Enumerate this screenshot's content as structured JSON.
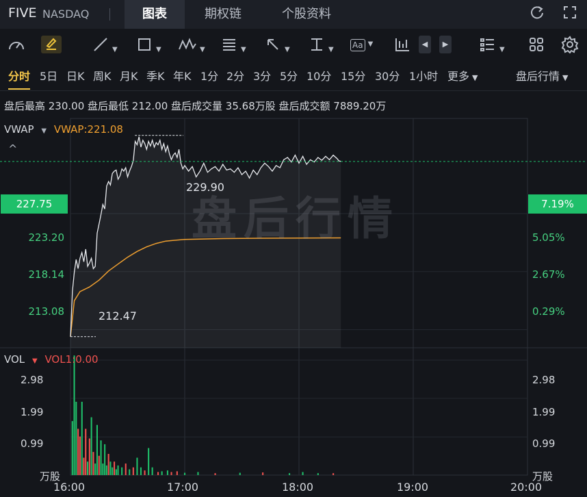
{
  "header": {
    "symbol": "FIVE",
    "exchange": "NASDAQ",
    "tabs": [
      {
        "label": "图表",
        "active": true
      },
      {
        "label": "期权链",
        "active": false
      },
      {
        "label": "个股资料",
        "active": false
      }
    ]
  },
  "toolbar": {
    "icons": [
      "gauge-icon",
      "pencil-icon",
      "line-tool-icon",
      "rectangle-icon",
      "pattern-icon",
      "fib-icon",
      "arrow-icon",
      "vertical-line-icon",
      "text-icon",
      "candle-icon",
      "list-icon",
      "grid-icon",
      "settings-icon"
    ],
    "text_tool_label": "Aa"
  },
  "periods": {
    "items": [
      "分时",
      "5日",
      "日K",
      "周K",
      "月K",
      "季K",
      "年K",
      "1分",
      "2分",
      "3分",
      "5分",
      "10分",
      "15分",
      "30分",
      "1小时",
      "更多"
    ],
    "active": "分时",
    "session": "盘后行情"
  },
  "stats": "盘后最高 230.00  盘后最低 212.00  盘后成交量 35.68万股  盘后成交额 7889.20万",
  "price_panel": {
    "indicator": "VWAP",
    "indicator_value": "VWAP:221.08",
    "left_axis": [
      "227.75",
      "223.20",
      "218.14",
      "213.08"
    ],
    "right_axis": [
      "7.19%",
      "5.05%",
      "2.67%",
      "0.29%"
    ],
    "current_price": "227.75",
    "current_pct": "7.19%",
    "high_label": "229.90",
    "low_label": "212.47",
    "watermark": "盘后行情"
  },
  "volume_panel": {
    "indicator": "VOL",
    "indicator_value": "VOL1:0.00",
    "left_axis": [
      "2.98",
      "1.99",
      "0.99",
      "万股"
    ],
    "right_axis": [
      "2.98",
      "1.99",
      "0.99",
      "万股"
    ]
  },
  "time_axis": [
    "16:00",
    "17:00",
    "18:00",
    "19:00",
    "20:00"
  ],
  "colors": {
    "up": "#1fbf6a",
    "down": "#f0524f",
    "vwap": "#f0a030",
    "accent": "#f3c64a"
  },
  "chart_data": {
    "type": "line",
    "x_start": "16:00",
    "x_end": "20:00",
    "minutes": [
      0,
      1,
      2,
      3,
      4,
      5,
      6,
      7,
      8,
      9,
      10,
      11,
      12,
      13,
      14,
      15,
      16,
      17,
      18,
      19,
      20,
      21,
      22,
      23,
      24,
      25,
      26,
      27,
      28,
      29,
      30,
      31,
      32,
      33,
      34,
      35,
      36,
      37,
      38,
      39,
      40,
      41,
      42,
      43,
      44,
      45,
      46,
      47,
      48,
      49,
      50,
      51,
      52,
      53,
      54,
      55,
      56,
      57,
      58,
      59,
      60,
      62,
      64,
      66,
      68,
      70,
      72,
      74,
      76,
      78,
      80,
      82,
      84,
      86,
      88,
      90,
      92,
      94,
      96,
      98,
      100,
      102,
      104,
      106,
      108,
      110,
      112,
      114,
      116,
      118,
      120,
      122,
      124,
      126,
      128,
      130,
      132,
      134,
      136,
      138,
      140,
      141,
      142
    ],
    "price": [
      212.47,
      216.4,
      218.1,
      219.2,
      218.4,
      219.3,
      219.8,
      219.0,
      220.1,
      218.6,
      218.9,
      219.3,
      218.4,
      218.6,
      221.5,
      222.3,
      223.1,
      224.0,
      223.6,
      225.6,
      226.0,
      225.7,
      226.7,
      226.9,
      227.0,
      226.2,
      226.5,
      227.1,
      226.9,
      227.2,
      226.4,
      226.9,
      227.3,
      227.8,
      229.5,
      229.2,
      229.9,
      229.0,
      229.6,
      229.3,
      228.8,
      229.5,
      229.1,
      229.6,
      229.0,
      229.4,
      229.2,
      229.6,
      228.8,
      229.3,
      228.6,
      229.1,
      228.4,
      227.9,
      228.3,
      228.5,
      228.1,
      228.8,
      227.6,
      227.1,
      227.4,
      226.9,
      227.3,
      226.4,
      226.9,
      227.6,
      226.8,
      227.1,
      227.3,
      226.9,
      227.5,
      227.0,
      227.1,
      226.8,
      227.2,
      226.6,
      226.9,
      226.3,
      227.0,
      226.6,
      227.2,
      227.6,
      227.3,
      226.9,
      227.4,
      227.2,
      227.9,
      228.1,
      227.7,
      228.3,
      227.6,
      228.2,
      227.5,
      227.9,
      227.7,
      228.1,
      227.85,
      228.2,
      227.9,
      228.3,
      228.0,
      227.8,
      227.75
    ],
    "vwap_series": [
      {
        "m": 0,
        "v": 212.47
      },
      {
        "m": 2,
        "v": 215.6
      },
      {
        "m": 5,
        "v": 216.4
      },
      {
        "m": 10,
        "v": 216.8
      },
      {
        "m": 15,
        "v": 217.4
      },
      {
        "m": 20,
        "v": 218.2
      },
      {
        "m": 25,
        "v": 218.8
      },
      {
        "m": 30,
        "v": 219.4
      },
      {
        "m": 35,
        "v": 219.9
      },
      {
        "m": 40,
        "v": 220.3
      },
      {
        "m": 45,
        "v": 220.6
      },
      {
        "m": 50,
        "v": 220.8
      },
      {
        "m": 60,
        "v": 220.95
      },
      {
        "m": 80,
        "v": 221.02
      },
      {
        "m": 100,
        "v": 221.05
      },
      {
        "m": 120,
        "v": 221.07
      },
      {
        "m": 142,
        "v": 221.08
      }
    ],
    "ylim": [
      211.5,
      231.5
    ],
    "volume": [
      {
        "m": 1,
        "v": 1.4,
        "d": "up"
      },
      {
        "m": 2,
        "v": 3.1,
        "d": "up"
      },
      {
        "m": 3,
        "v": 1.9,
        "d": "up"
      },
      {
        "m": 4,
        "v": 1.2,
        "d": "down"
      },
      {
        "m": 5,
        "v": 1.0,
        "d": "down"
      },
      {
        "m": 6,
        "v": 1.9,
        "d": "up"
      },
      {
        "m": 7,
        "v": 0.45,
        "d": "down"
      },
      {
        "m": 8,
        "v": 1.2,
        "d": "down"
      },
      {
        "m": 9,
        "v": 0.35,
        "d": "up"
      },
      {
        "m": 10,
        "v": 0.95,
        "d": "down"
      },
      {
        "m": 11,
        "v": 1.5,
        "d": "up"
      },
      {
        "m": 12,
        "v": 0.6,
        "d": "down"
      },
      {
        "m": 13,
        "v": 0.3,
        "d": "up"
      },
      {
        "m": 14,
        "v": 1.3,
        "d": "up"
      },
      {
        "m": 15,
        "v": 0.5,
        "d": "down"
      },
      {
        "m": 16,
        "v": 0.9,
        "d": "up"
      },
      {
        "m": 17,
        "v": 0.3,
        "d": "up"
      },
      {
        "m": 18,
        "v": 0.8,
        "d": "up"
      },
      {
        "m": 19,
        "v": 0.25,
        "d": "up"
      },
      {
        "m": 20,
        "v": 0.55,
        "d": "down"
      },
      {
        "m": 21,
        "v": 0.35,
        "d": "up"
      },
      {
        "m": 22,
        "v": 0.2,
        "d": "up"
      },
      {
        "m": 23,
        "v": 0.35,
        "d": "down"
      },
      {
        "m": 24,
        "v": 0.15,
        "d": "up"
      },
      {
        "m": 25,
        "v": 0.25,
        "d": "up"
      },
      {
        "m": 27,
        "v": 0.2,
        "d": "up"
      },
      {
        "m": 29,
        "v": 0.3,
        "d": "down"
      },
      {
        "m": 31,
        "v": 0.15,
        "d": "up"
      },
      {
        "m": 33,
        "v": 0.2,
        "d": "down"
      },
      {
        "m": 35,
        "v": 0.45,
        "d": "up"
      },
      {
        "m": 37,
        "v": 0.2,
        "d": "up"
      },
      {
        "m": 39,
        "v": 0.12,
        "d": "down"
      },
      {
        "m": 41,
        "v": 0.7,
        "d": "up"
      },
      {
        "m": 43,
        "v": 0.2,
        "d": "up"
      },
      {
        "m": 46,
        "v": 0.08,
        "d": "down"
      },
      {
        "m": 48,
        "v": 0.1,
        "d": "up"
      },
      {
        "m": 51,
        "v": 0.12,
        "d": "up"
      },
      {
        "m": 53,
        "v": 0.08,
        "d": "down"
      },
      {
        "m": 56,
        "v": 0.1,
        "d": "down"
      },
      {
        "m": 60,
        "v": 0.06,
        "d": "up"
      },
      {
        "m": 67,
        "v": 0.08,
        "d": "up"
      },
      {
        "m": 76,
        "v": 0.05,
        "d": "down"
      },
      {
        "m": 89,
        "v": 0.06,
        "d": "up"
      },
      {
        "m": 101,
        "v": 0.07,
        "d": "down"
      },
      {
        "m": 115,
        "v": 0.05,
        "d": "up"
      },
      {
        "m": 122,
        "v": 0.08,
        "d": "up"
      },
      {
        "m": 130,
        "v": 0.05,
        "d": "up"
      },
      {
        "m": 138,
        "v": 0.05,
        "d": "down"
      }
    ],
    "volume_ylim": [
      0,
      3.3
    ]
  }
}
